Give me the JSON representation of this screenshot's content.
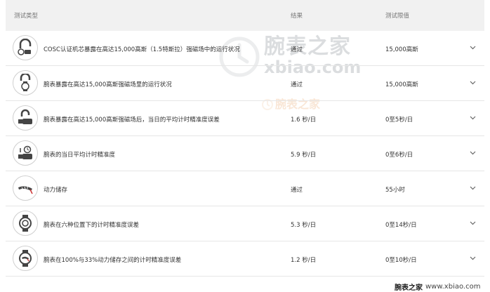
{
  "header": {
    "col_type": "测试类型",
    "col_result": "结果",
    "col_limit": "测试限值"
  },
  "rows": [
    {
      "icon": "magnet-watch-icon",
      "name": "COSC认证机芯暴露在高达15,000高斯（1.5特斯拉）强磁场中的运行状况",
      "result": "通过",
      "limit": "15,000高斯"
    },
    {
      "icon": "magnet-wristwatch-icon",
      "name": "腕表暴露在高达15,000高斯强磁场里的运行状况",
      "result": "通过",
      "limit": "15,000高斯"
    },
    {
      "icon": "magnet-precision-icon",
      "name": "腕表暴露在高达15,000高斯强磁场后，当日的平均计时精准度误差",
      "result": "1.6 秒/日",
      "limit": "0至5秒/日"
    },
    {
      "icon": "daily-precision-icon",
      "name": "腕表的当日平均计时精准度",
      "result": "5.9 秒/日",
      "limit": "0至6秒/日"
    },
    {
      "icon": "power-reserve-icon",
      "name": "动力储存",
      "result": "通过",
      "limit": "55小时"
    },
    {
      "icon": "six-positions-icon",
      "name": "腕表在六种位置下的计时精准度误差",
      "result": "5.3 秒/日",
      "limit": "0至14秒/日"
    },
    {
      "icon": "power-reserve-accuracy-icon",
      "name": "腕表在100%与33%动力储存之间的计时精准度误差",
      "result": "1.2 秒/日",
      "limit": "0至10秒/日"
    }
  ],
  "watermark": {
    "brand_cn": "腕表之家",
    "brand_en": "xbiao.com",
    "footer_cn": "腕表之家",
    "footer_en": "www.xbiao.com"
  },
  "colors": {
    "header_bg": "#f1f1f1",
    "divider": "#e6e6e6"
  }
}
